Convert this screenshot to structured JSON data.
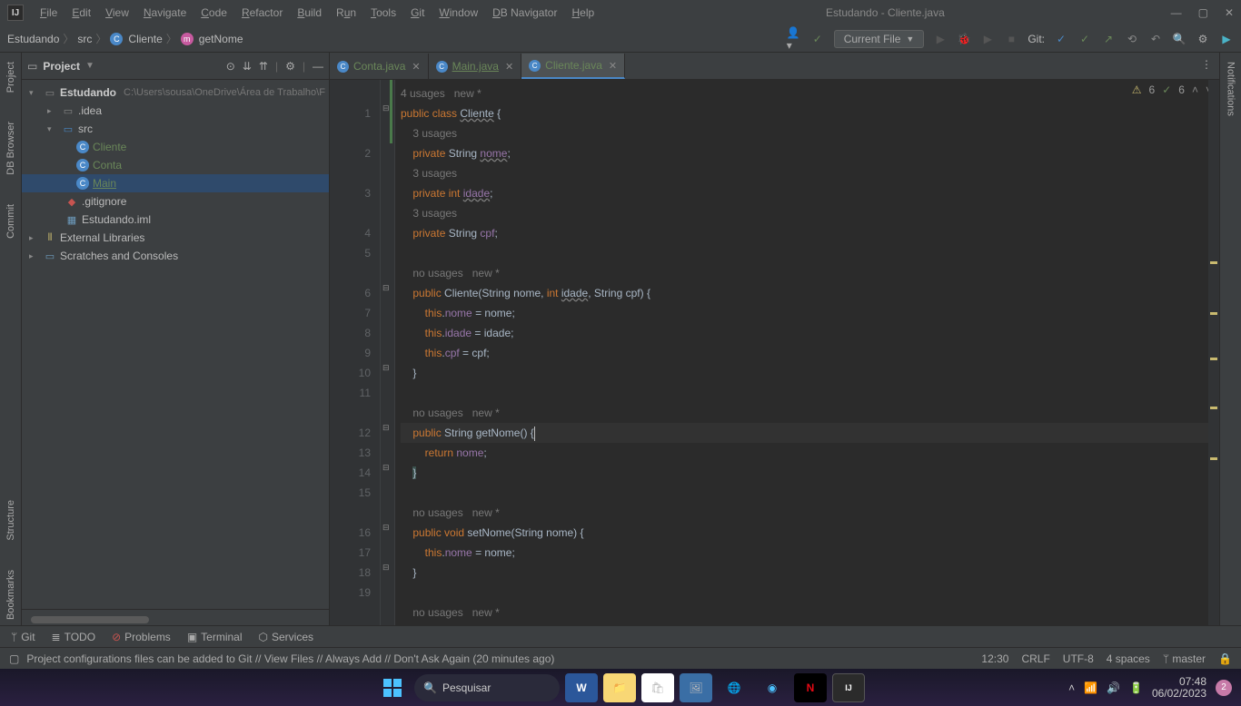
{
  "titlebar": {
    "menus": [
      "File",
      "Edit",
      "View",
      "Navigate",
      "Code",
      "Refactor",
      "Build",
      "Run",
      "Tools",
      "Git",
      "Window",
      "DB Navigator",
      "Help"
    ],
    "title": "Estudando - Cliente.java"
  },
  "breadcrumb": {
    "project": "Estudando",
    "src": "src",
    "class": "Cliente",
    "method": "getNome"
  },
  "runconfig": {
    "label": "Current File",
    "git_label": "Git:"
  },
  "project_panel": {
    "title": "Project"
  },
  "tree": {
    "root": "Estudando",
    "rootpath": "C:\\Users\\sousa\\OneDrive\\Área de Trabalho\\F",
    "idea": ".idea",
    "src": "src",
    "cliente": "Cliente",
    "conta": "Conta",
    "main": "Main",
    "gitignore": ".gitignore",
    "iml": "Estudando.iml",
    "external": "External Libraries",
    "scratch": "Scratches and Consoles"
  },
  "tabs": [
    {
      "name": "Conta.java"
    },
    {
      "name": "Main.java"
    },
    {
      "name": "Cliente.java"
    }
  ],
  "inspections": {
    "warn": "6",
    "ok": "6"
  },
  "hints": {
    "u4": "4 usages",
    "u3": "3 usages",
    "nou": "no usages",
    "new": "new *"
  },
  "code": {
    "kw_public": "public",
    "kw_class": "class",
    "kw_private": "private",
    "kw_int": "int",
    "kw_void": "void",
    "kw_this": "this",
    "kw_return": "return",
    "cls": "Cliente",
    "t_string": "String",
    "f_nome": "nome",
    "f_idade": "idade",
    "f_cpf": "cpf",
    "m_getNome": "getNome",
    "m_setNome": "setNome"
  },
  "lines": [
    "1",
    "2",
    "3",
    "4",
    "5",
    "6",
    "7",
    "8",
    "9",
    "10",
    "11",
    "12",
    "13",
    "14",
    "15",
    "16",
    "17",
    "18",
    "19"
  ],
  "bottom": {
    "git": "Git",
    "todo": "TODO",
    "problems": "Problems",
    "terminal": "Terminal",
    "services": "Services"
  },
  "status": {
    "msg": "Project configurations files can be added to Git // View Files // Always Add // Don't Ask Again (20 minutes ago)",
    "pos": "12:30",
    "sep": "CRLF",
    "enc": "UTF-8",
    "indent": "4 spaces",
    "branch": "master"
  },
  "left_tools": [
    "Project",
    "DB Browser",
    "Commit",
    "Structure",
    "Bookmarks"
  ],
  "right_tools": [
    "Notifications"
  ],
  "taskbar": {
    "search": "Pesquisar",
    "time": "07:48",
    "date": "06/02/2023",
    "badge": "2"
  }
}
